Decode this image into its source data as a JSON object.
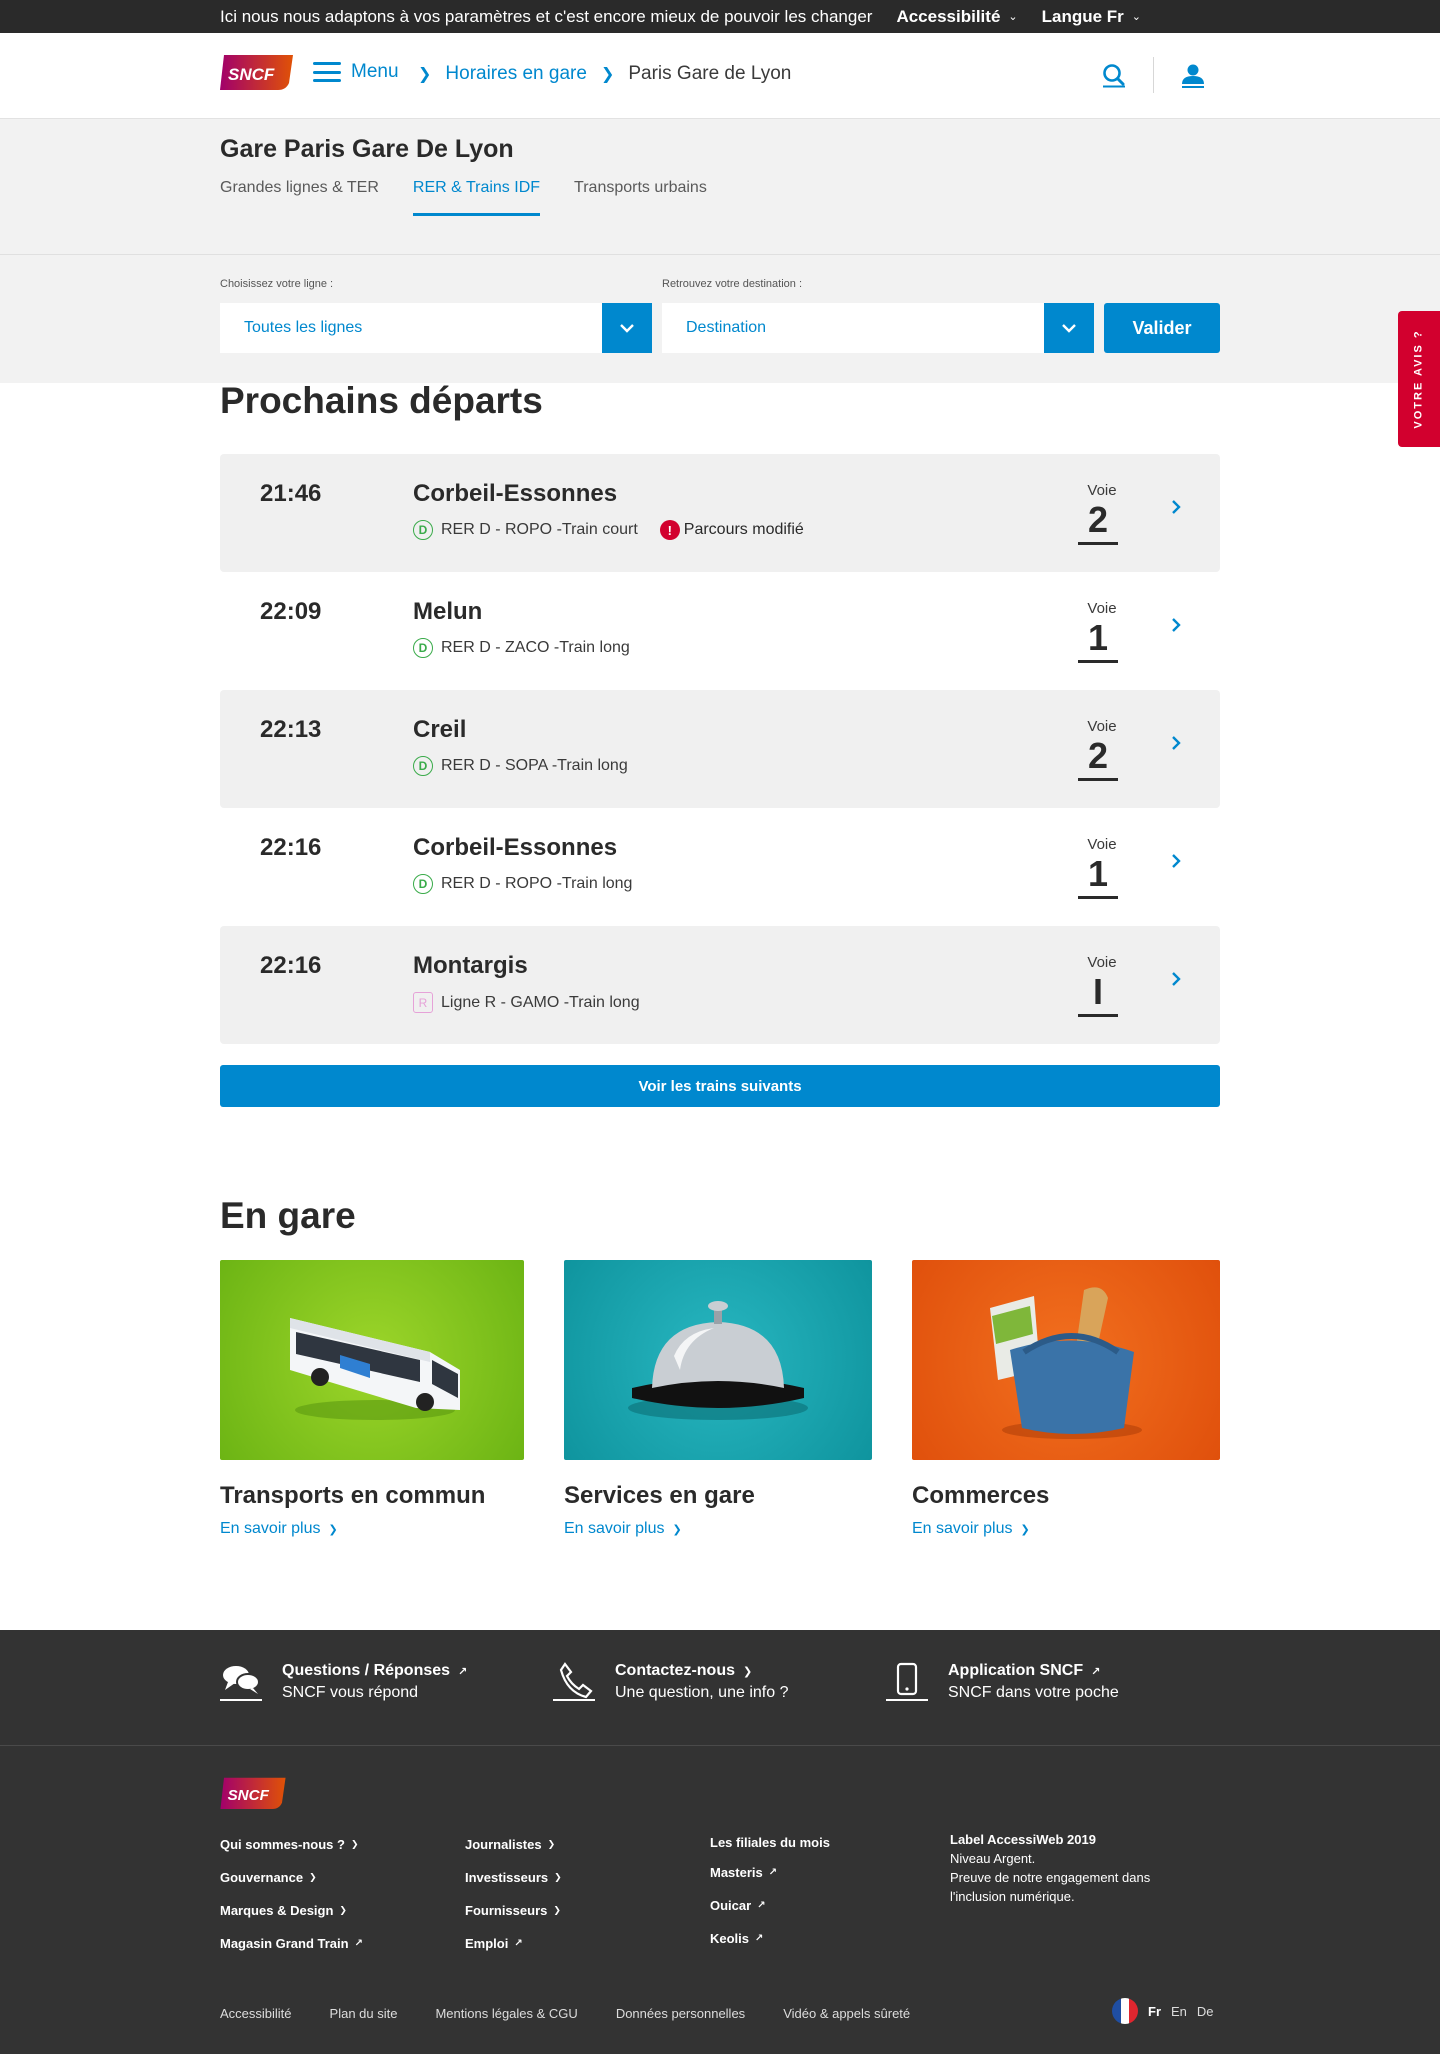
{
  "topbar": {
    "message": "Ici nous nous adaptons à vos paramètres et c'est encore mieux de pouvoir les changer",
    "accessibility": "Accessibilité",
    "language": "Langue Fr"
  },
  "header": {
    "logo_text": "SNCF",
    "menu": "Menu",
    "breadcrumb": [
      "Horaires en gare",
      "Paris Gare de Lyon"
    ]
  },
  "station": {
    "title": "Gare Paris Gare De Lyon",
    "tabs": [
      "Grandes lignes & TER",
      "RER & Trains IDF",
      "Transports urbains"
    ],
    "active_tab": 1
  },
  "filters": {
    "line_label": "Choisissez votre ligne :",
    "line_value": "Toutes les lignes",
    "dest_label": "Retrouvez votre destination :",
    "dest_value": "Destination",
    "submit": "Valider"
  },
  "feedback": "VOTRE AVIS ?",
  "departures": {
    "title": "Prochains départs",
    "voie_label": "Voie",
    "items": [
      {
        "time": "21:46",
        "destination": "Corbeil-Essonnes",
        "line_badge": "D",
        "line": "RER D - ROPO -Train court",
        "alert": "Parcours modifié",
        "voie": "2"
      },
      {
        "time": "22:09",
        "destination": "Melun",
        "line_badge": "D",
        "line": "RER D - ZACO -Train long",
        "alert": "",
        "voie": "1"
      },
      {
        "time": "22:13",
        "destination": "Creil",
        "line_badge": "D",
        "line": "RER D - SOPA -Train long",
        "alert": "",
        "voie": "2"
      },
      {
        "time": "22:16",
        "destination": "Corbeil-Essonnes",
        "line_badge": "D",
        "line": "RER D - ROPO -Train long",
        "alert": "",
        "voie": "1"
      },
      {
        "time": "22:16",
        "destination": "Montargis",
        "line_badge": "R",
        "line": "Ligne R - GAMO -Train long",
        "alert": "",
        "voie": "I"
      }
    ],
    "more": "Voir les trains suivants"
  },
  "en_gare": {
    "title": "En gare",
    "cards": [
      {
        "title": "Transports en commun",
        "link": "En savoir plus",
        "color": "#7dc31e"
      },
      {
        "title": "Services en gare",
        "link": "En savoir plus",
        "color": "#15a2ad"
      },
      {
        "title": "Commerces",
        "link": "En savoir plus",
        "color": "#ea5a13"
      }
    ]
  },
  "footer": {
    "help": [
      {
        "title": "Questions / Réponses",
        "subtitle": "SNCF vous répond",
        "icon": "chat-icon"
      },
      {
        "title": "Contactez-nous",
        "subtitle": "Une question, une info ?",
        "icon": "phone-icon"
      },
      {
        "title": "Application SNCF",
        "subtitle": "SNCF dans votre poche",
        "icon": "mobile-icon"
      }
    ],
    "col1": [
      "Qui sommes-nous ?",
      "Gouvernance",
      "Marques & Design",
      "Magasin Grand Train"
    ],
    "col2": [
      "Journalistes",
      "Investisseurs",
      "Fournisseurs",
      "Emploi"
    ],
    "col3_title": "Les filiales du mois",
    "col3": [
      "Masteris",
      "Ouicar",
      "Keolis"
    ],
    "label_title": "Label AccessiWeb 2019",
    "label_lines": [
      "Niveau Argent.",
      "Preuve de notre engagement dans",
      "l'inclusion numérique."
    ],
    "bottom_links": [
      "Accessibilité",
      "Plan du site",
      "Mentions légales & CGU",
      "Données personnelles",
      "Vidéo & appels sûreté"
    ],
    "languages": [
      "Fr",
      "En",
      "De"
    ]
  },
  "colors": {
    "accent": "#0088ce",
    "alert": "#d2002e",
    "rer_d": "#3aab4a",
    "ligne_r": "#e6a2d8",
    "footer_bg": "#333333"
  }
}
